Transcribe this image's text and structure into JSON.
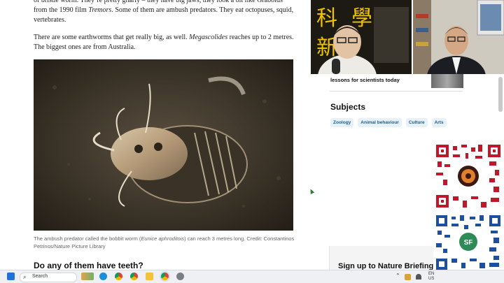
{
  "article": {
    "para1_pre": "of bristle worm. They’re pretty gnarly – they have big jaws, they look a bit like Graboids from the 1990 film ",
    "para1_em": "Tremors",
    "para1_post": ". Some of them are ambush predators. They eat octopuses, squid, vertebrates.",
    "para2_pre": "There are some earthworms that get really big, as well. ",
    "para2_em": "Megascolides",
    "para2_post": " reaches up to 2 metres. The biggest ones are from Australia.",
    "caption_pre": "The ambush predator called the bobbit worm (",
    "caption_em": "Eunice aphroditois",
    "caption_post": ") can reach 3 metres long.  Credit: Constantinos Petrinos/Nature Picture Library",
    "heading": "Do any of them have teeth?"
  },
  "sidebar": {
    "lessons": "lessons for scientists today",
    "subjects_title": "Subjects",
    "tags": [
      "Zoology",
      "Animal behaviour",
      "Culture",
      "Arts"
    ],
    "signup": "Sign up to Nature Briefing"
  },
  "overlay": {
    "logo_chars": [
      "科",
      "學",
      "新"
    ],
    "presenter_badge": "SF"
  },
  "taskbar": {
    "search_label": "Search",
    "lang": "EN",
    "lang2": "US"
  },
  "colors": {
    "tag_bg": "#e8f1f8",
    "tag_text": "#1f5d8a",
    "qr_red": "#c0172a",
    "qr_blue": "#1c4fa0",
    "logo_gold": "#f0c300"
  }
}
